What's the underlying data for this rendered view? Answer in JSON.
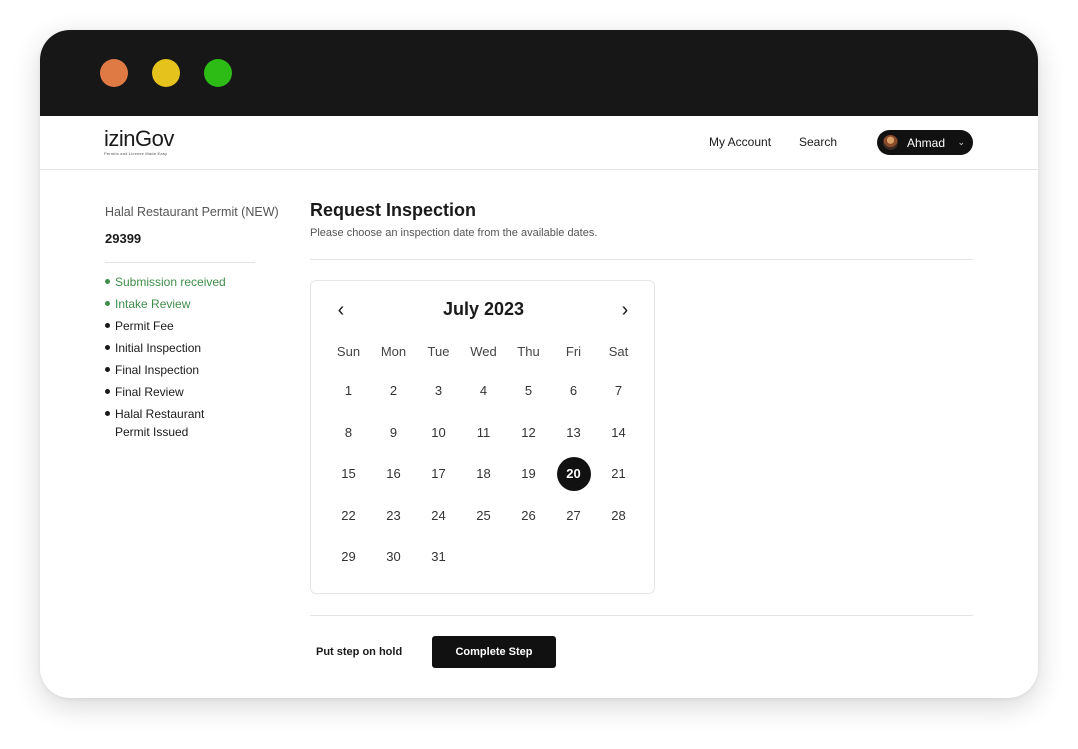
{
  "window": {
    "controls": {
      "close_color": "#e07a45",
      "minimize_color": "#e6c21c",
      "maximize_color": "#2dbb16"
    }
  },
  "header": {
    "logo_text": "izinGov",
    "logo_tagline": "Permits and License Made Easy",
    "nav": {
      "my_account": "My Account",
      "search": "Search"
    },
    "user": {
      "name": "Ahmad",
      "chevron_icon": "chevron-down-icon"
    }
  },
  "sidebar": {
    "permit_title": "Halal Restaurant Permit (NEW)",
    "permit_number": "29399",
    "steps": [
      {
        "label": "Submission received",
        "status": "done"
      },
      {
        "label": "Intake Review",
        "status": "done"
      },
      {
        "label": "Permit Fee",
        "status": "pending"
      },
      {
        "label": "Initial Inspection",
        "status": "pending"
      },
      {
        "label": "Final Inspection",
        "status": "pending"
      },
      {
        "label": "Final Review",
        "status": "pending"
      },
      {
        "label": "Halal Restaurant Permit Issued",
        "status": "pending"
      }
    ],
    "done_color": "#3e8e4a"
  },
  "main": {
    "title": "Request Inspection",
    "subtitle": "Please choose an inspection date from the available dates."
  },
  "calendar": {
    "month_label": "July 2023",
    "prev_icon": "‹",
    "next_icon": "›",
    "weekdays": [
      "Sun",
      "Mon",
      "Tue",
      "Wed",
      "Thu",
      "Fri",
      "Sat"
    ],
    "weeks": [
      [
        "1",
        "2",
        "3",
        "4",
        "5",
        "6",
        "7"
      ],
      [
        "8",
        "9",
        "10",
        "11",
        "12",
        "13",
        "14"
      ],
      [
        "15",
        "16",
        "17",
        "18",
        "19",
        "20",
        "21"
      ],
      [
        "22",
        "23",
        "24",
        "25",
        "26",
        "27",
        "28"
      ],
      [
        "29",
        "30",
        "31"
      ]
    ],
    "selected_day": "20"
  },
  "actions": {
    "hold_label": "Put step on hold",
    "complete_label": "Complete Step"
  }
}
